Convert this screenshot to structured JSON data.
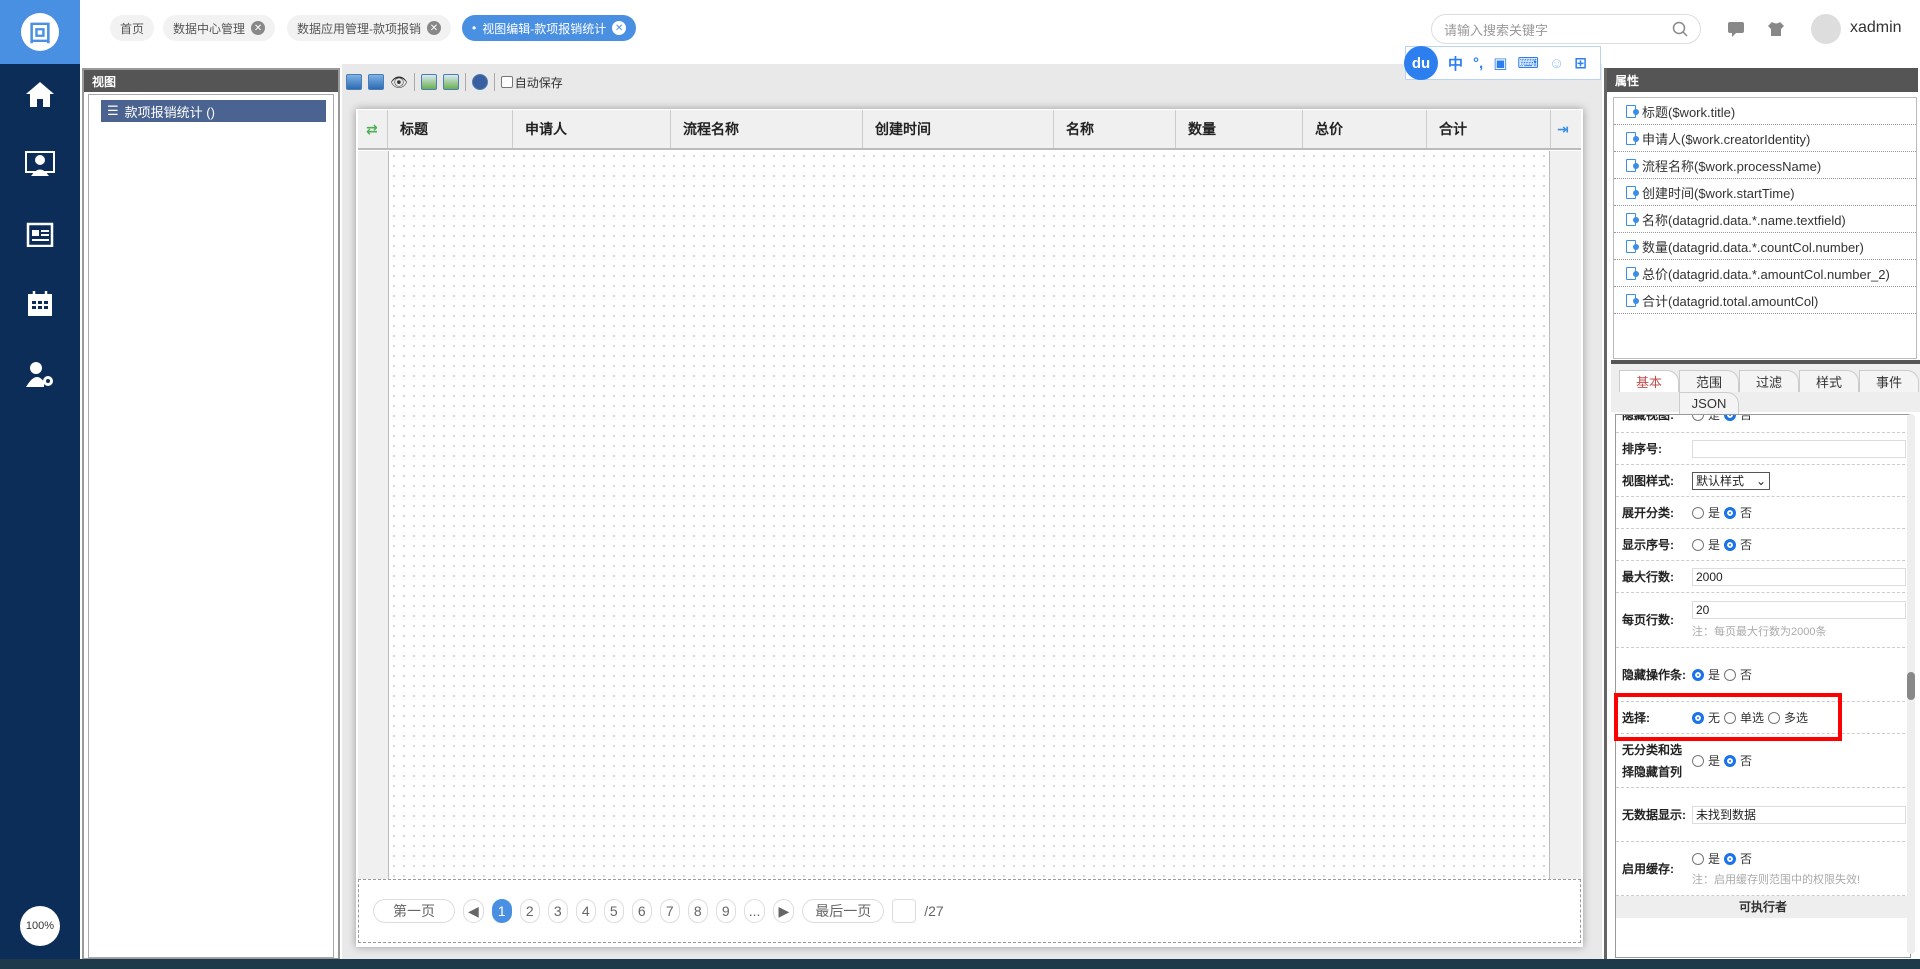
{
  "sidebar": {
    "items": [
      "home",
      "desktop-user",
      "news",
      "calendar",
      "user-settings"
    ],
    "zoom": "100%"
  },
  "tabs": [
    {
      "label": "首页"
    },
    {
      "label": "数据中心管理"
    },
    {
      "label": "数据应用管理-款项报销"
    },
    {
      "label": "视图编辑-款项报销统计",
      "active": true
    }
  ],
  "header": {
    "search_placeholder": "请输入搜索关键字",
    "username": "xadmin"
  },
  "ime": {
    "logo": "du",
    "items": [
      "中",
      "°,"
    ]
  },
  "left_panel": {
    "title": "视图",
    "tree_item": "款项报销统计 ()"
  },
  "toolbar": {
    "autosave_label": "自动保存",
    "autosave_checked": false
  },
  "grid": {
    "columns": [
      "标题",
      "申请人",
      "流程名称",
      "创建时间",
      "名称",
      "数量",
      "总价",
      "合计"
    ]
  },
  "pager": {
    "first": "第一页",
    "last": "最后一页",
    "pages": [
      "1",
      "2",
      "3",
      "4",
      "5",
      "6",
      "7",
      "8",
      "9",
      "..."
    ],
    "current": "1",
    "total": "/27",
    "page_input": ""
  },
  "right_panel": {
    "title": "属性",
    "properties": [
      "标题($work.title)",
      "申请人($work.creatorIdentity)",
      "流程名称($work.processName)",
      "创建时间($work.startTime)",
      "名称(datagrid.data.*.name.textfield)",
      "数量(datagrid.data.*.countCol.number)",
      "总价(datagrid.data.*.amountCol.number_2)",
      "合计(datagrid.total.amountCol)"
    ],
    "tabs": [
      "基本",
      "范围",
      "过滤",
      "样式",
      "事件",
      "JSON"
    ],
    "form": {
      "hidden_view": {
        "label": "隐藏视图:",
        "yes": "是",
        "no": "否"
      },
      "order": {
        "label": "排序号:",
        "value": ""
      },
      "style": {
        "label": "视图样式:",
        "value": "默认样式"
      },
      "expand": {
        "label": "展开分类:",
        "yes": "是",
        "no": "否"
      },
      "show_seq": {
        "label": "显示序号:",
        "yes": "是",
        "no": "否"
      },
      "max_rows": {
        "label": "最大行数:",
        "value": "2000"
      },
      "page_rows": {
        "label": "每页行数:",
        "value": "20",
        "note": "注：每页最大行数为2000条"
      },
      "hide_actionbar": {
        "label": "隐藏操作条:",
        "yes": "是",
        "no": "否"
      },
      "select": {
        "label": "选择:",
        "none": "无",
        "single": "单选",
        "multi": "多选"
      },
      "hide_first_col": {
        "label": "无分类和选择隐藏首列",
        "yes": "是",
        "no": "否"
      },
      "no_data": {
        "label": "无数据显示:",
        "value": "未找到数据"
      },
      "cache": {
        "label": "启用缓存:",
        "yes": "是",
        "no": "否",
        "note": "注：启用缓存则范围中的权限失效!"
      },
      "executor": {
        "label": "可执行者"
      }
    }
  },
  "colors": {
    "accent": "#4a90e2",
    "sidebar": "#0c2d57",
    "highlight": "#ff0000"
  }
}
